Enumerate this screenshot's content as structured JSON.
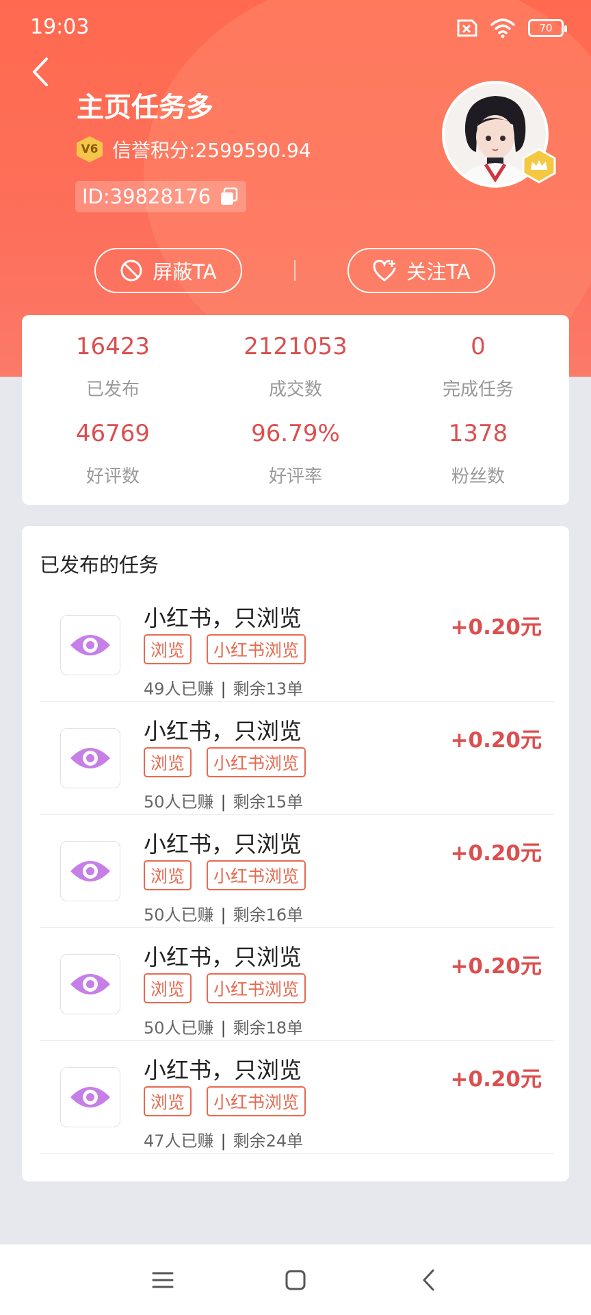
{
  "status_bar": {
    "time": "19:03",
    "battery": "70"
  },
  "header": {
    "title": "主页任务多",
    "level_badge": "V6",
    "credit_label": "信誉积分:2599590.94",
    "user_id": "ID:39828176"
  },
  "actions": {
    "block_label": "屏蔽TA",
    "follow_label": "关注TA"
  },
  "stats": [
    {
      "value": "16423",
      "label": "已发布"
    },
    {
      "value": "2121053",
      "label": "成交数"
    },
    {
      "value": "0",
      "label": "完成任务"
    },
    {
      "value": "46769",
      "label": "好评数"
    },
    {
      "value": "96.79%",
      "label": "好评率"
    },
    {
      "value": "1378",
      "label": "粉丝数"
    }
  ],
  "tasks_section": {
    "title": "已发布的任务",
    "items": [
      {
        "title": "小红书，只浏览",
        "tags": [
          "浏览",
          "小红书浏览"
        ],
        "earned": "49人已赚",
        "remaining": "剩余13单",
        "reward": "+0.20元"
      },
      {
        "title": "小红书，只浏览",
        "tags": [
          "浏览",
          "小红书浏览"
        ],
        "earned": "50人已赚",
        "remaining": "剩余15单",
        "reward": "+0.20元"
      },
      {
        "title": "小红书，只浏览",
        "tags": [
          "浏览",
          "小红书浏览"
        ],
        "earned": "50人已赚",
        "remaining": "剩余16单",
        "reward": "+0.20元"
      },
      {
        "title": "小红书，只浏览",
        "tags": [
          "浏览",
          "小红书浏览"
        ],
        "earned": "50人已赚",
        "remaining": "剩余18单",
        "reward": "+0.20元"
      },
      {
        "title": "小红书，只浏览",
        "tags": [
          "浏览",
          "小红书浏览"
        ],
        "earned": "47人已赚",
        "remaining": "剩余24单",
        "reward": "+0.20元"
      }
    ]
  },
  "colors": {
    "header": "#ff6a4f",
    "accent_red": "#dc4f4f",
    "tag_orange": "#e8694f",
    "eye_purple": "#c77fe8"
  },
  "icons": [
    "back-arrow-icon",
    "block-icon",
    "heart-plus-icon",
    "copy-icon",
    "crown-icon",
    "eye-icon",
    "menu-icon",
    "home-square-icon",
    "back-nav-icon"
  ]
}
